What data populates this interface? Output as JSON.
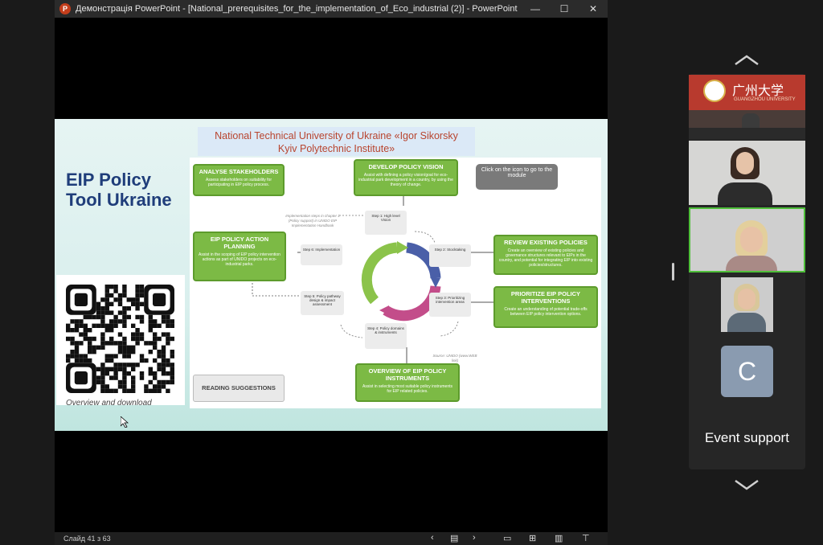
{
  "window": {
    "app_letter": "P",
    "title": "Демонстрація PowerPoint - [National_prerequisites_for_the_implementation_of_Eco_industrial (2)] - PowerPoint",
    "controls": [
      "—",
      "☐",
      "✕"
    ]
  },
  "slide": {
    "header_line1": "National Technical University of Ukraine «Igor Sikorsky",
    "header_line2": "Kyiv Polytechnic Institute»",
    "title_line1": "EIP Policy",
    "title_line2": "Tool Ukraine",
    "qr_caption": "Overview and download",
    "boxes": {
      "analyse": {
        "heading": "ANALYSE STAKEHOLDERS",
        "body": "Assess stakeholders on suitability for participating in EIP policy process."
      },
      "develop": {
        "heading": "DEVELOP POLICY VISION",
        "body": "Assist with defining a policy vision/goal for eco-industrial park development in a country, by using the theory of change."
      },
      "action": {
        "heading": "EIP POLICY ACTION PLANNING",
        "body": "Assist in the scoping of EIP policy intervention actions as part of UNIDO projects on eco-industrial parks."
      },
      "review": {
        "heading": "REVIEW EXISTING POLICIES",
        "body": "Create an overview of existing policies and governance structures relevant to EIPs in the country, and potential for integrating EIP into existing policies/structures."
      },
      "prioritize": {
        "heading": "PRIORITIZE EIP POLICY INTERVENTIONS",
        "body": "Create an understanding of potential trade-offs between EIP policy intervention options."
      },
      "overview": {
        "heading": "OVERVIEW OF EIP POLICY INSTRUMENTS",
        "body": "Assist in selecting most suitable policy instruments for EIP related policies."
      }
    },
    "callout": "Click on the icon to go to the module",
    "reading": "READING SUGGESTIONS",
    "note": "Implementation steps in chapter 1 (Policy support) in UNIDO EIP Implementation Handbook",
    "steps": {
      "s1": "Step 1: High level Vision",
      "s2": "Step 2: Stocktaking",
      "s3": "Step 3: Prioritizing intervention areas",
      "s4": "Step 4: Policy domains & instruments",
      "s5": "Step 5: Policy pathway design & impact assessment",
      "s6": "Step 6: Implementation"
    },
    "source": "Source: UNIDO (www.WEB link)"
  },
  "statusbar": {
    "slide_counter": "Слайд 41 з 63"
  },
  "gallery": {
    "tile1_sign": "广州大学",
    "tile1_sub": "GUANGZHOU UNIVERSITY",
    "avatar_initial": "C",
    "event_label": "Event support"
  },
  "colors": {
    "accent_green": "#7cba45",
    "title_blue": "#1f3d7a",
    "header_red": "#b8442e",
    "active_border": "#4fbf3a"
  }
}
